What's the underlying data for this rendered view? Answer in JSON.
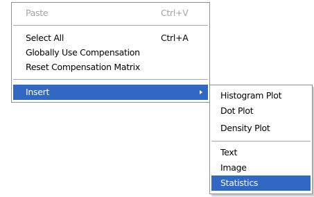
{
  "main_menu": {
    "paste": {
      "label": "Paste",
      "shortcut": "Ctrl+V"
    },
    "select_all": {
      "label": "Select All",
      "shortcut": "Ctrl+A"
    },
    "globally_use_compensation": {
      "label": "Globally Use Compensation"
    },
    "reset_compensation_matrix": {
      "label": "Reset Compensation Matrix"
    },
    "insert": {
      "label": "Insert"
    }
  },
  "insert_submenu": {
    "histogram_plot": "Histogram Plot",
    "dot_plot": "Dot Plot",
    "density_plot": "Density Plot",
    "text": "Text",
    "image": "Image",
    "statistics": "Statistics"
  },
  "colors": {
    "highlight": "#3168c4",
    "disabled_text": "#a3a3a3",
    "border": "#8f8f8f"
  },
  "icons": {
    "submenu_arrow": "chevron-right-icon"
  }
}
